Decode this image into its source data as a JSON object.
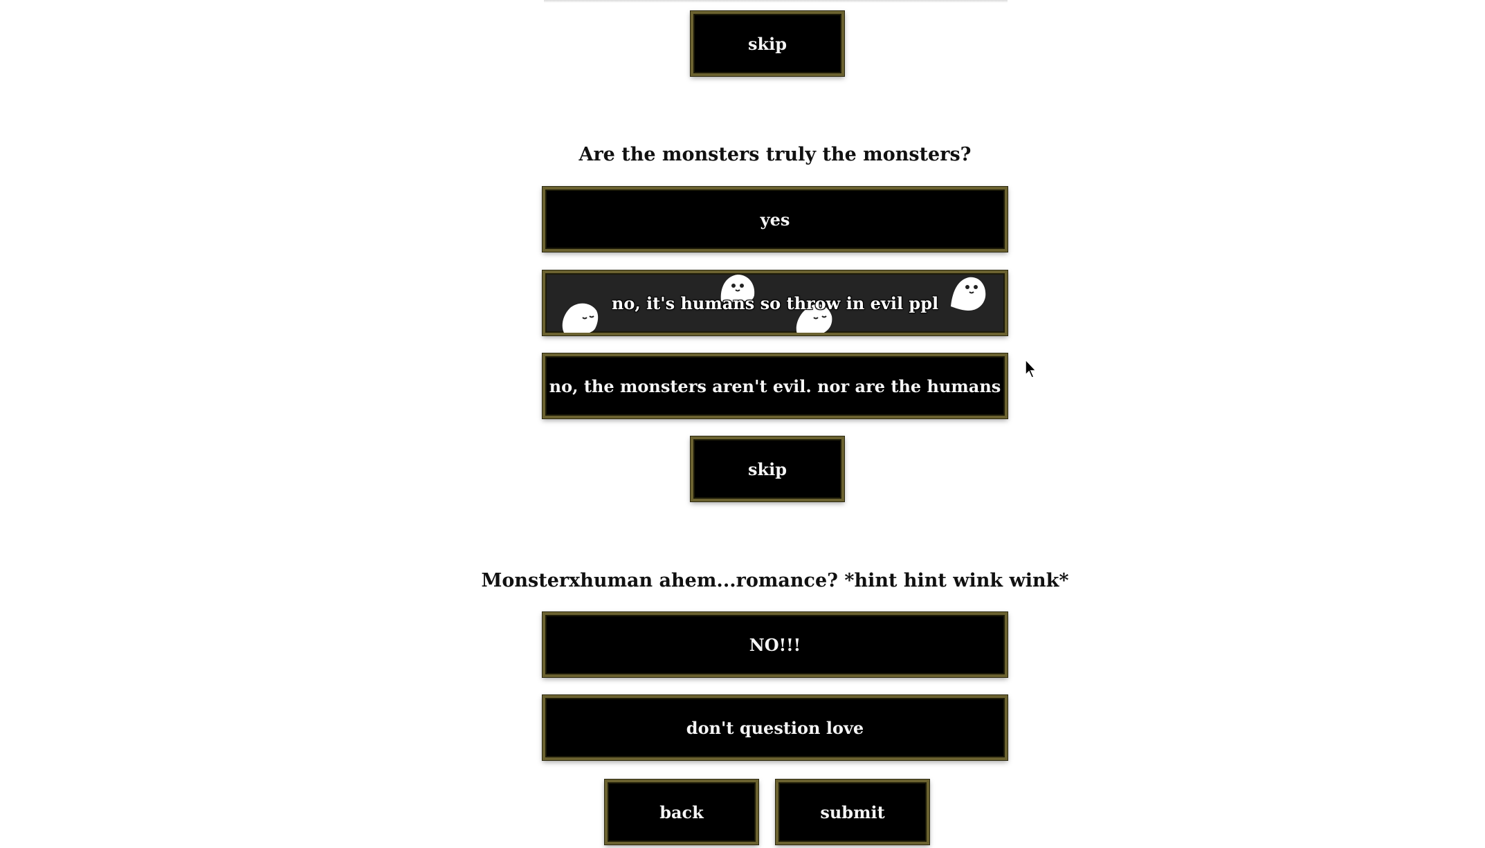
{
  "questions": [
    {
      "title": "Are the monsters truly the monsters?",
      "options": [
        "yes",
        "no, it's humans so throw in evil ppl",
        "no, the monsters aren't evil. nor are the humans"
      ],
      "selected_option": "no, it's humans so throw in evil ppl"
    },
    {
      "title": "Monsterxhuman ahem...romance? *hint hint wink wink*",
      "options": [
        "NO!!!",
        "don't question love"
      ]
    }
  ],
  "skip_label": "skip",
  "nav": {
    "back_label": "back",
    "submit_label": "submit"
  },
  "icons": {
    "selected_decoration": "ghost-icon",
    "pointer": "mouse-cursor-icon"
  },
  "colors": {
    "button_bg": "#000000",
    "selected_bg": "#242424",
    "button_border": "#6b6230",
    "page_bg": "#ffffff"
  }
}
